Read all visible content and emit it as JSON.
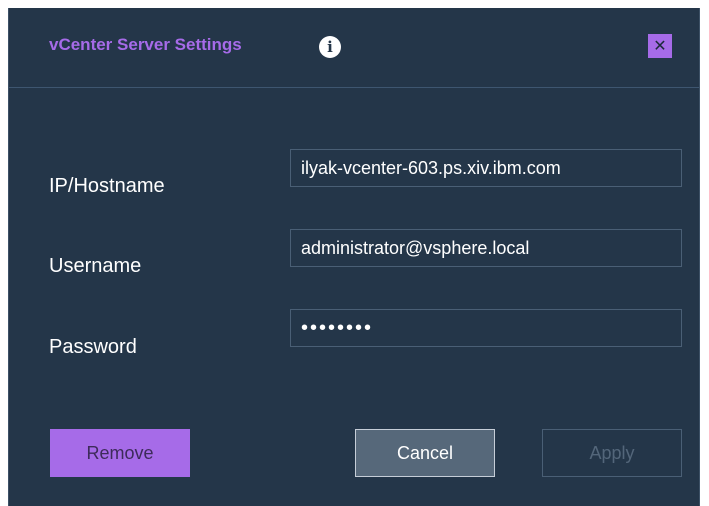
{
  "dialog": {
    "title": "vCenter Server Settings",
    "info_icon": "info-icon",
    "info_glyph": "i",
    "close_icon": "close-icon",
    "close_glyph": "✕"
  },
  "fields": {
    "hostname": {
      "label": "IP/Hostname",
      "value": "ilyak-vcenter-603.ps.xiv.ibm.com"
    },
    "username": {
      "label": "Username",
      "value": "administrator@vsphere.local"
    },
    "password": {
      "label": "Password",
      "value": "••••••••"
    }
  },
  "buttons": {
    "remove": "Remove",
    "cancel": "Cancel",
    "apply": "Apply"
  },
  "colors": {
    "background": "#243649",
    "accent": "#a66be8",
    "text": "#ffffff",
    "disabled_text": "#53667a"
  }
}
